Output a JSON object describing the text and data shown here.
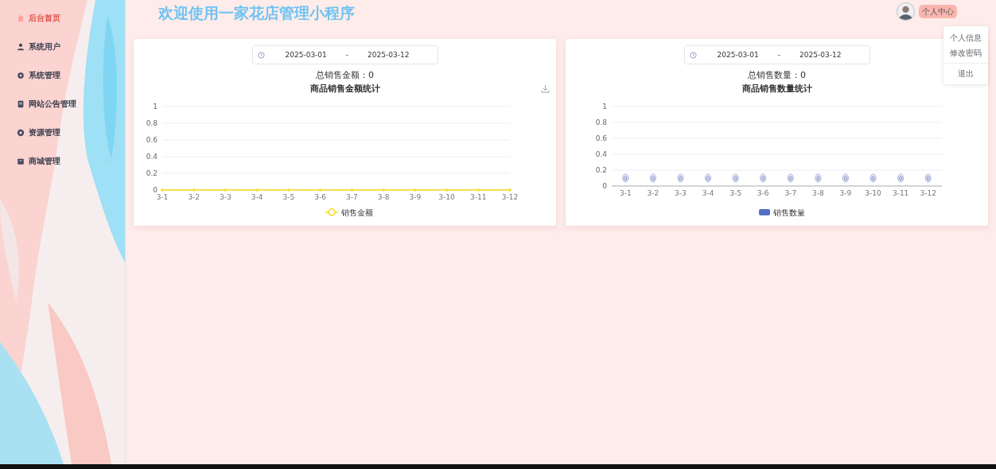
{
  "sidebar": {
    "items": [
      {
        "label": "后台首页",
        "selected": true,
        "expandable": false
      },
      {
        "label": "系统用户",
        "selected": false,
        "expandable": true
      },
      {
        "label": "系统管理",
        "selected": false,
        "expandable": true
      },
      {
        "label": "网站公告管理",
        "selected": false,
        "expandable": true
      },
      {
        "label": "资源管理",
        "selected": false,
        "expandable": true
      },
      {
        "label": "商城管理",
        "selected": false,
        "expandable": true
      }
    ]
  },
  "header": {
    "title": "欢迎使用一家花店管理小程序",
    "user_button": "个人中心"
  },
  "user_menu": {
    "items": [
      "个人信息",
      "修改密码",
      "退出"
    ]
  },
  "panels": [
    {
      "date_from": "2025-03-01",
      "separator": "-",
      "date_to": "2025-03-12",
      "total": "总销售金额：0",
      "download": true,
      "chart_data": {
        "type": "line",
        "title": "商品销售金额统计",
        "categories": [
          "3-1",
          "3-2",
          "3-3",
          "3-4",
          "3-5",
          "3-6",
          "3-7",
          "3-8",
          "3-9",
          "3-10",
          "3-11",
          "3-12"
        ],
        "yticks": [
          0,
          0.2,
          0.4,
          0.6,
          0.8,
          1
        ],
        "ylim": [
          0,
          1
        ],
        "grid": true,
        "series": [
          {
            "name": "销售金额",
            "color": "#f8e04b",
            "values": [
              0,
              0,
              0,
              0,
              0,
              0,
              0,
              0,
              0,
              0,
              0,
              0
            ]
          }
        ]
      }
    },
    {
      "date_from": "2025-03-01",
      "separator": "-",
      "date_to": "2025-03-12",
      "total": "总销售数量：0",
      "download": false,
      "chart_data": {
        "type": "bar",
        "title": "商品销售数量统计",
        "categories": [
          "3-1",
          "3-2",
          "3-3",
          "3-4",
          "3-5",
          "3-6",
          "3-7",
          "3-8",
          "3-9",
          "3-10",
          "3-11",
          "3-12"
        ],
        "yticks": [
          0,
          0.2,
          0.4,
          0.6,
          0.8,
          1
        ],
        "ylim": [
          0,
          1
        ],
        "grid": true,
        "data_labels": true,
        "series": [
          {
            "name": "销售数量",
            "color": "#5470c6",
            "values": [
              0,
              0,
              0,
              0,
              0,
              0,
              0,
              0,
              0,
              0,
              0,
              0
            ]
          }
        ]
      }
    }
  ]
}
